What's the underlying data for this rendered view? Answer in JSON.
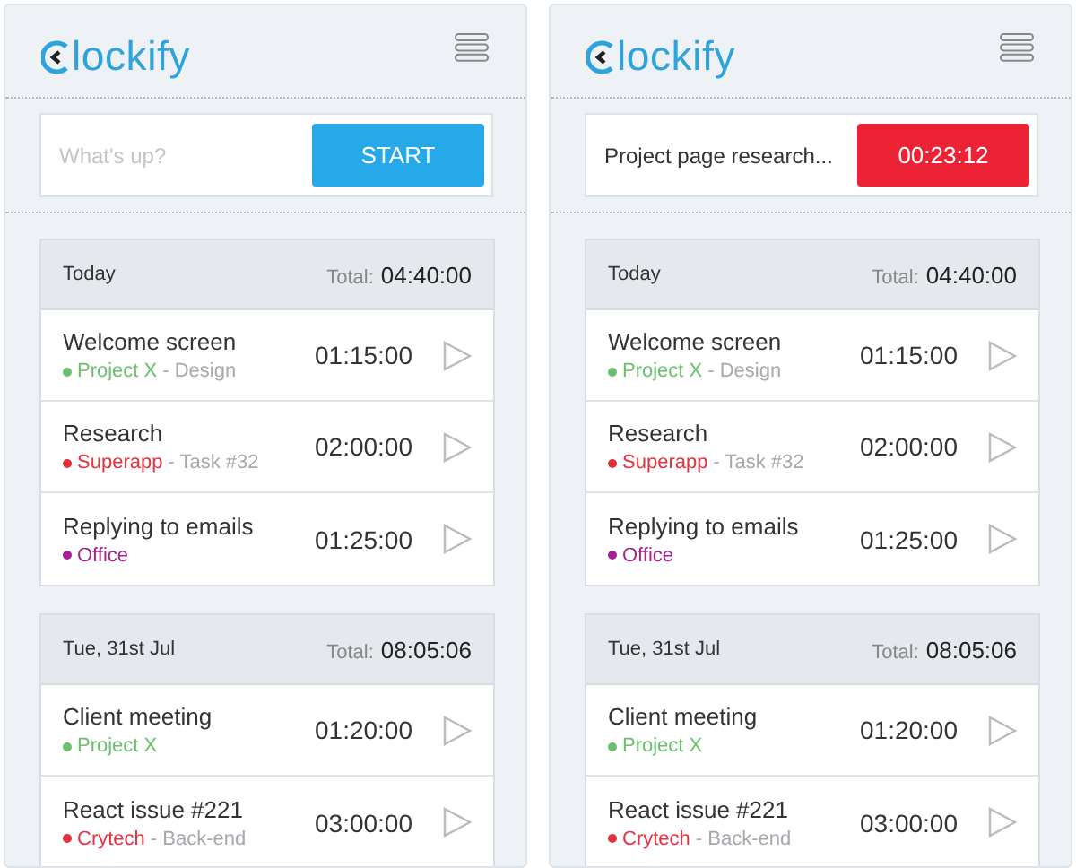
{
  "panels": [
    {
      "logo": "lockify",
      "timer": {
        "kind": "idle",
        "placeholder": "What's up?",
        "button": "START"
      },
      "groups": [
        {
          "date": "Today",
          "total_label": "Total:",
          "total": "04:40:00",
          "entries": [
            {
              "title": "Welcome screen",
              "project": "Project X",
              "color": "#6cbf6c",
              "task": "- Design",
              "duration": "01:15:00"
            },
            {
              "title": "Research",
              "project": "Superapp",
              "color": "#e4313c",
              "task": "- Task #32",
              "duration": "02:00:00"
            },
            {
              "title": "Replying to emails",
              "project": "Office",
              "color": "#a8238f",
              "duration": "01:25:00"
            }
          ]
        },
        {
          "date": "Tue, 31st Jul",
          "total_label": "Total:",
          "total": "08:05:06",
          "entries": [
            {
              "title": "Client meeting",
              "project": "Project X",
              "color": "#6cbf6c",
              "duration": "01:20:00"
            },
            {
              "title": "React issue #221",
              "project": "Crytech",
              "color": "#e4313c",
              "task": "- Back-end",
              "duration": "03:00:00"
            }
          ]
        }
      ]
    },
    {
      "logo": "lockify",
      "timer": {
        "kind": "running",
        "value": "Project page research...",
        "button": "00:23:12"
      },
      "groups": [
        {
          "date": "Today",
          "total_label": "Total:",
          "total": "04:40:00",
          "entries": [
            {
              "title": "Welcome screen",
              "project": "Project X",
              "color": "#6cbf6c",
              "task": "- Design",
              "duration": "01:15:00"
            },
            {
              "title": "Research",
              "project": "Superapp",
              "color": "#e4313c",
              "task": "- Task #32",
              "duration": "02:00:00"
            },
            {
              "title": "Replying to emails",
              "project": "Office",
              "color": "#a8238f",
              "duration": "01:25:00"
            }
          ]
        },
        {
          "date": "Tue, 31st Jul",
          "total_label": "Total:",
          "total": "08:05:06",
          "entries": [
            {
              "title": "Client meeting",
              "project": "Project X",
              "color": "#6cbf6c",
              "duration": "01:20:00"
            },
            {
              "title": "React issue #221",
              "project": "Crytech",
              "color": "#e4313c",
              "task": "- Back-end",
              "duration": "03:00:00"
            }
          ]
        }
      ]
    }
  ]
}
